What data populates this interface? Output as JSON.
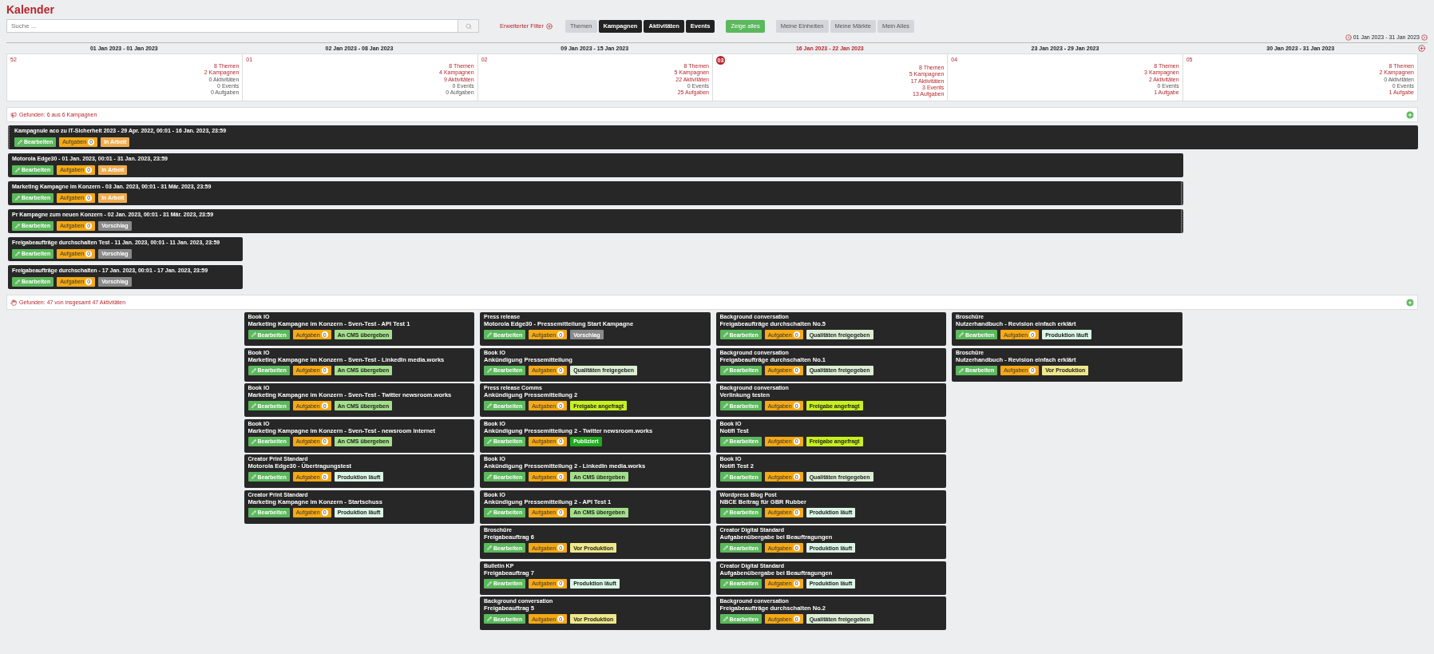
{
  "title": "Kalender",
  "search": {
    "placeholder": "Suche ..."
  },
  "advanced_filter": {
    "label": "Erweiterter Filter"
  },
  "filters": [
    {
      "label": "Themen",
      "kind": "toggle",
      "selected": false
    },
    {
      "label": "Kampagnen",
      "kind": "toggle",
      "selected": true
    },
    {
      "label": "Aktivitäten",
      "kind": "toggle",
      "selected": true
    },
    {
      "label": "Events",
      "kind": "toggle",
      "selected": true
    },
    {
      "label": "Zeige alles",
      "kind": "show_all",
      "selected": false
    },
    {
      "label": "Meine Einheiten",
      "kind": "scope",
      "selected": false
    },
    {
      "label": "Meine Märkte",
      "kind": "scope",
      "selected": false
    },
    {
      "label": "Mein Alles",
      "kind": "scope",
      "selected": false
    }
  ],
  "date_range": "01 Jan 2023 - 31 Jan 2023",
  "weeks": [
    {
      "range": "01 Jan 2023 - 01 Jan 2023",
      "number": "52",
      "current": false,
      "stats": [
        {
          "text": "8 Themen",
          "active": true
        },
        {
          "text": "2 Kampagnen",
          "active": true
        },
        {
          "text": "0 Aktivitäten",
          "active": false
        },
        {
          "text": "0 Events",
          "active": false
        },
        {
          "text": "0 Aufgaben",
          "active": false
        }
      ]
    },
    {
      "range": "02 Jan 2023 - 08 Jan 2023",
      "number": "01",
      "current": false,
      "stats": [
        {
          "text": "8 Themen",
          "active": true
        },
        {
          "text": "4 Kampagnen",
          "active": true
        },
        {
          "text": "9 Aktivitäten",
          "active": true
        },
        {
          "text": "0 Events",
          "active": false
        },
        {
          "text": "0 Aufgaben",
          "active": false
        }
      ],
      "activities": [
        {
          "type": "Book IO",
          "title": "Marketing Kampagne im Konzern - Sven-Test - API Test 1",
          "edit": "Bearbeiten",
          "tasks_label": "Aufgaben",
          "tasks": "0",
          "status": {
            "label": "An CMS übergeben",
            "kind": "cms"
          }
        },
        {
          "type": "Book IO",
          "title": "Marketing Kampagne im Konzern - Sven-Test - LinkedIn media.works",
          "edit": "Bearbeiten",
          "tasks_label": "Aufgaben",
          "tasks": "0",
          "status": {
            "label": "An CMS übergeben",
            "kind": "cms"
          }
        },
        {
          "type": "Book IO",
          "title": "Marketing Kampagne im Konzern - Sven-Test - Twitter newsroom.works",
          "edit": "Bearbeiten",
          "tasks_label": "Aufgaben",
          "tasks": "0",
          "status": {
            "label": "An CMS übergeben",
            "kind": "cms"
          }
        },
        {
          "type": "Book IO",
          "title": "Marketing Kampagne im Konzern - Sven-Test - newsroom Internet",
          "edit": "Bearbeiten",
          "tasks_label": "Aufgaben",
          "tasks": "0",
          "status": {
            "label": "An CMS übergeben",
            "kind": "cms"
          }
        },
        {
          "type": "Creator Print Standard",
          "title": "Motorola Edge30 - Übertragungstest",
          "edit": "Bearbeiten",
          "tasks_label": "Aufgaben",
          "tasks": "0",
          "status": {
            "label": "Produktion läuft",
            "kind": "production"
          }
        },
        {
          "type": "Creator Print Standard",
          "title": "Marketing Kampagne im Konzern - Startschuss",
          "edit": "Bearbeiten",
          "tasks_label": "Aufgaben",
          "tasks": "0",
          "status": {
            "label": "Produktion läuft",
            "kind": "production"
          }
        }
      ]
    },
    {
      "range": "09 Jan 2023 - 15 Jan 2023",
      "number": "02",
      "current": false,
      "stats": [
        {
          "text": "8 Themen",
          "active": true
        },
        {
          "text": "5 Kampagnen",
          "active": true
        },
        {
          "text": "22 Aktivitäten",
          "active": true
        },
        {
          "text": "0 Events",
          "active": false
        },
        {
          "text": "25 Aufgaben",
          "active": true
        }
      ],
      "activities": [
        {
          "type": "Press release",
          "title": "Motorola Edge30 - Pressemitteilung Start Kampagne",
          "edit": "Bearbeiten",
          "tasks_label": "Aufgaben",
          "tasks": "0",
          "status": {
            "label": "Vorschlag",
            "kind": "proposal"
          }
        },
        {
          "type": "Book IO",
          "title": "Ankündigung Pressemitteilung",
          "edit": "Bearbeiten",
          "tasks_label": "Aufgaben",
          "tasks": "0",
          "status": {
            "label": "Qualitäten freigegeben",
            "kind": "quality"
          }
        },
        {
          "type": "Press release Comms",
          "title": "Ankündigung Pressemitteilung 2",
          "edit": "Bearbeiten",
          "tasks_label": "Aufgaben",
          "tasks": "0",
          "status": {
            "label": "Freigabe angefragt",
            "kind": "approval"
          }
        },
        {
          "type": "Book IO",
          "title": "Ankündigung Pressemitteilung 2 - Twitter newsroom.works",
          "edit": "Bearbeiten",
          "tasks_label": "Aufgaben",
          "tasks": "0",
          "status": {
            "label": "Publiziert",
            "kind": "published"
          }
        },
        {
          "type": "Book IO",
          "title": "Ankündigung Pressemitteilung 2 - LinkedIn media.works",
          "edit": "Bearbeiten",
          "tasks_label": "Aufgaben",
          "tasks": "0",
          "status": {
            "label": "An CMS übergeben",
            "kind": "cms"
          }
        },
        {
          "type": "Book IO",
          "title": "Ankündigung Pressemitteilung 2 - API Test 1",
          "edit": "Bearbeiten",
          "tasks_label": "Aufgaben",
          "tasks": "0",
          "status": {
            "label": "An CMS übergeben",
            "kind": "cms"
          }
        },
        {
          "type": "Broschüre",
          "title": "Freigabeauftrag 6",
          "edit": "Bearbeiten",
          "tasks_label": "Aufgaben",
          "tasks": "0",
          "status": {
            "label": "Vor Produktion",
            "kind": "pre_production"
          }
        },
        {
          "type": "Bulletin KP",
          "title": "Freigabeauftrag 7",
          "edit": "Bearbeiten",
          "tasks_label": "Aufgaben",
          "tasks": "0",
          "status": {
            "label": "Produktion läuft",
            "kind": "production"
          }
        },
        {
          "type": "Background conversation",
          "title": "Freigabeauftrag 5",
          "edit": "Bearbeiten",
          "tasks_label": "Aufgaben",
          "tasks": "0",
          "status": {
            "label": "Vor Produktion",
            "kind": "pre_production"
          }
        }
      ]
    },
    {
      "range": "16 Jan 2023 - 22 Jan 2023",
      "number": "03",
      "current": true,
      "stats": [
        {
          "text": "8 Themen",
          "active": true
        },
        {
          "text": "5 Kampagnen",
          "active": true
        },
        {
          "text": "17 Aktivitäten",
          "active": true
        },
        {
          "text": "3 Events",
          "active": true
        },
        {
          "text": "13 Aufgaben",
          "active": true
        }
      ],
      "activities": [
        {
          "type": "Background conversation",
          "title": "Freigabeaufträge durchschalten No.5",
          "edit": "Bearbeiten",
          "tasks_label": "Aufgaben",
          "tasks": "0",
          "status": {
            "label": "Qualitäten freigegeben",
            "kind": "quality"
          }
        },
        {
          "type": "Background conversation",
          "title": "Freigabeaufträge durchschalten No.1",
          "edit": "Bearbeiten",
          "tasks_label": "Aufgaben",
          "tasks": "0",
          "status": {
            "label": "Qualitäten freigegeben",
            "kind": "quality"
          }
        },
        {
          "type": "Background conversation",
          "title": "Verlinkung testen",
          "edit": "Bearbeiten",
          "tasks_label": "Aufgaben",
          "tasks": "0",
          "status": {
            "label": "Freigabe angefragt",
            "kind": "approval"
          }
        },
        {
          "type": "Book IO",
          "title": "Notifi Test",
          "edit": "Bearbeiten",
          "tasks_label": "Aufgaben",
          "tasks": "0",
          "status": {
            "label": "Freigabe angefragt",
            "kind": "approval"
          }
        },
        {
          "type": "Book IO",
          "title": "Notifi Test 2",
          "edit": "Bearbeiten",
          "tasks_label": "Aufgaben",
          "tasks": "0",
          "status": {
            "label": "Qualitäten freigegeben",
            "kind": "quality"
          }
        },
        {
          "type": "Wordpress Blog Post",
          "title": "NBCE Beitrag für GBR Rubber",
          "edit": "Bearbeiten",
          "tasks_label": "Aufgaben",
          "tasks": "0",
          "status": {
            "label": "Produktion läuft",
            "kind": "production"
          }
        },
        {
          "type": "Creator Digital Standard",
          "title": "Aufgabenübergabe bei Beauftragungen",
          "edit": "Bearbeiten",
          "tasks_label": "Aufgaben",
          "tasks": "0",
          "status": {
            "label": "Produktion läuft",
            "kind": "production"
          }
        },
        {
          "type": "Creator Digital Standard",
          "title": "Aufgabenübergabe bei Beauftragungen",
          "edit": "Bearbeiten",
          "tasks_label": "Aufgaben",
          "tasks": "0",
          "status": {
            "label": "Produktion läuft",
            "kind": "production"
          }
        },
        {
          "type": "Background conversation",
          "title": "Freigabeaufträge durchschalten No.2",
          "edit": "Bearbeiten",
          "tasks_label": "Aufgaben",
          "tasks": "0",
          "status": {
            "label": "Qualitäten freigegeben",
            "kind": "quality"
          }
        }
      ]
    },
    {
      "range": "23 Jan 2023 - 29 Jan 2023",
      "number": "04",
      "current": false,
      "stats": [
        {
          "text": "8 Themen",
          "active": true
        },
        {
          "text": "3 Kampagnen",
          "active": true
        },
        {
          "text": "2 Aktivitäten",
          "active": true
        },
        {
          "text": "0 Events",
          "active": false
        },
        {
          "text": "1 Aufgabe",
          "active": true
        }
      ],
      "activities": [
        {
          "type": "Broschüre",
          "title": "Nutzerhandbuch - Revision einfach erklärt",
          "edit": "Bearbeiten",
          "tasks_label": "Aufgaben",
          "tasks": "0",
          "status": {
            "label": "Produktion läuft",
            "kind": "production"
          }
        },
        {
          "type": "Broschüre",
          "title": "Nutzerhandbuch - Revision einfach erklärt",
          "edit": "Bearbeiten",
          "tasks_label": "Aufgaben",
          "tasks": "0",
          "status": {
            "label": "Vor Produktion",
            "kind": "pre_production"
          }
        }
      ]
    },
    {
      "range": "30 Jan 2023 - 31 Jan 2023",
      "number": "05",
      "current": false,
      "stats": [
        {
          "text": "8 Themen",
          "active": true
        },
        {
          "text": "2 Kampagnen",
          "active": true
        },
        {
          "text": "0 Aktivitäten",
          "active": false
        },
        {
          "text": "0 Events",
          "active": false
        },
        {
          "text": "1 Aufgabe",
          "active": true
        }
      ]
    }
  ],
  "campaigns_section": {
    "label": "Gefunden: 6 aus 6 Kampagnen"
  },
  "campaigns": [
    {
      "title": "Kampagnule aco zu IT-Sicherheit 2023 - 29 Apr. 2022, 00:01 - 16 Jan. 2023, 23:59",
      "kind": "six_weeks",
      "continues_before": true,
      "continues_after": false,
      "edit": "Bearbeiten",
      "tasks_label": "Aufgaben",
      "tasks": "0",
      "status": {
        "label": "In Arbeit",
        "kind": "in_progress"
      }
    },
    {
      "title": "Motorola Edge30 - 01 Jan. 2023, 00:01 - 31 Jan. 2023, 23:59",
      "kind": "five_weeks",
      "continues_before": false,
      "continues_after": false,
      "edit": "Bearbeiten",
      "tasks_label": "Aufgaben",
      "tasks": "0",
      "status": {
        "label": "In Arbeit",
        "kind": "in_progress"
      }
    },
    {
      "title": "Marketing Kampagne im Konzern - 03 Jan. 2023, 00:01 - 31 Mär. 2023, 23:59",
      "kind": "five_weeks",
      "continues_before": false,
      "continues_after": true,
      "edit": "Bearbeiten",
      "tasks_label": "Aufgaben",
      "tasks": "0",
      "status": {
        "label": "In Arbeit",
        "kind": "in_progress"
      }
    },
    {
      "title": "Pr Kampagne zum neuen Konzern - 02 Jan. 2023, 00:01 - 31 Mär. 2023, 23:59",
      "kind": "five_weeks",
      "continues_before": false,
      "continues_after": true,
      "edit": "Bearbeiten",
      "tasks_label": "Aufgaben",
      "tasks": "0",
      "status": {
        "label": "Vorschlag",
        "kind": "proposal"
      }
    },
    {
      "title": "Freigabeaufträge durchschalten Test - 11 Jan. 2023, 00:01 - 11 Jan. 2023, 23:59",
      "kind": "one_week",
      "continues_before": false,
      "continues_after": false,
      "edit": "Bearbeiten",
      "tasks_label": "Aufgaben",
      "tasks": "0",
      "status": {
        "label": "Vorschlag",
        "kind": "proposal"
      }
    },
    {
      "title": "Freigabeaufträge durchschalten - 17 Jan. 2023, 00:01 - 17 Jan. 2023, 23:59",
      "kind": "one_week",
      "continues_before": false,
      "continues_after": false,
      "edit": "Bearbeiten",
      "tasks_label": "Aufgaben",
      "tasks": "0",
      "status": {
        "label": "Vorschlag",
        "kind": "proposal"
      }
    }
  ],
  "activities_section": {
    "label": "Gefunden: 47 von insgesamt 47 Aktivitäten"
  }
}
